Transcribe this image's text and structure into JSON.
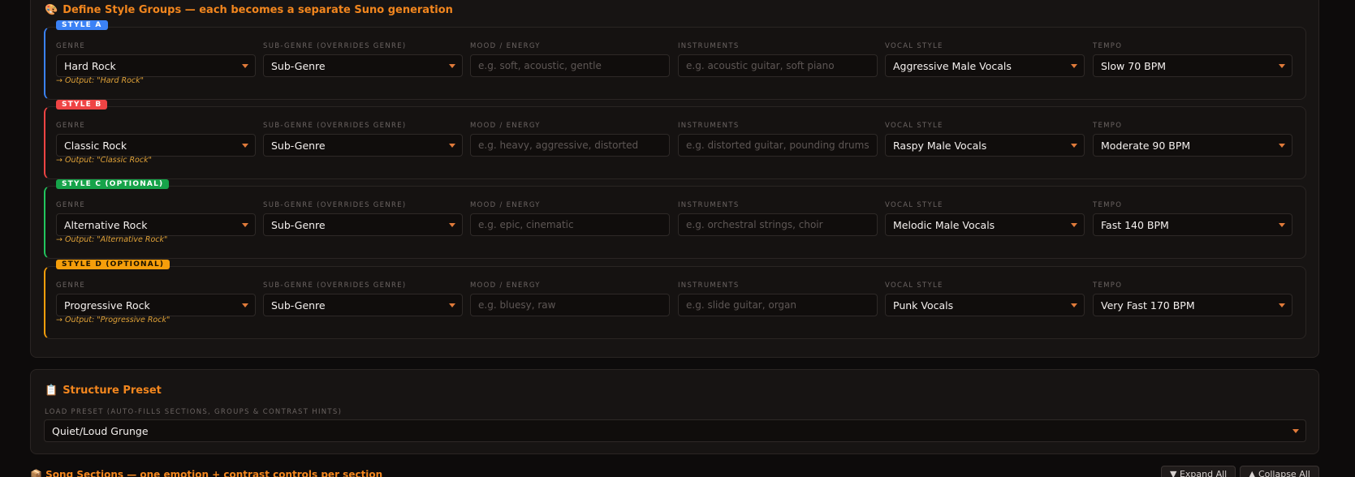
{
  "style_groups_panel": {
    "icon": "palette-icon",
    "title": "Define Style Groups — each becomes a separate Suno generation",
    "field_labels": {
      "genre": "GENRE",
      "subgenre": "SUB-GENRE (OVERRIDES GENRE)",
      "mood": "MOOD / ENERGY",
      "instruments": "INSTRUMENTS",
      "vocal": "VOCAL STYLE",
      "tempo": "TEMPO"
    },
    "groups": [
      {
        "badge": "STYLE A",
        "genre": "Hard Rock",
        "subgenre": "Sub-Genre",
        "mood_placeholder": "e.g. soft, acoustic, gentle",
        "instruments_placeholder": "e.g. acoustic guitar, soft piano",
        "vocal": "Aggressive Male Vocals",
        "tempo": "Slow 70 BPM",
        "output": "→ Output: \"Hard Rock\""
      },
      {
        "badge": "STYLE B",
        "genre": "Classic Rock",
        "subgenre": "Sub-Genre",
        "mood_placeholder": "e.g. heavy, aggressive, distorted",
        "instruments_placeholder": "e.g. distorted guitar, pounding drums",
        "vocal": "Raspy Male Vocals",
        "tempo": "Moderate 90 BPM",
        "output": "→ Output: \"Classic Rock\""
      },
      {
        "badge": "STYLE C (OPTIONAL)",
        "genre": "Alternative Rock",
        "subgenre": "Sub-Genre",
        "mood_placeholder": "e.g. epic, cinematic",
        "instruments_placeholder": "e.g. orchestral strings, choir",
        "vocal": "Melodic Male Vocals",
        "tempo": "Fast 140 BPM",
        "output": "→ Output: \"Alternative Rock\""
      },
      {
        "badge": "STYLE D (OPTIONAL)",
        "genre": "Progressive Rock",
        "subgenre": "Sub-Genre",
        "mood_placeholder": "e.g. bluesy, raw",
        "instruments_placeholder": "e.g. slide guitar, organ",
        "vocal": "Punk Vocals",
        "tempo": "Very Fast 170 BPM",
        "output": "→ Output: \"Progressive Rock\""
      }
    ]
  },
  "structure_panel": {
    "icon": "clipboard-icon",
    "title": "Structure Preset",
    "preset_label": "LOAD PRESET (AUTO-FILLS SECTIONS, GROUPS & CONTRAST HINTS)",
    "preset_value": "Quiet/Loud Grunge"
  },
  "song_sections": {
    "icon": "music-box-icon",
    "title": "Song Sections — one emotion + contrast controls per section",
    "expand_label": "▼ Expand All",
    "collapse_label": "▲ Collapse All"
  },
  "colors": {
    "accent": "#f2861e",
    "style_a": "#3b82f6",
    "style_b": "#ef4444",
    "style_c": "#22c55e",
    "style_d": "#f59e0b"
  }
}
